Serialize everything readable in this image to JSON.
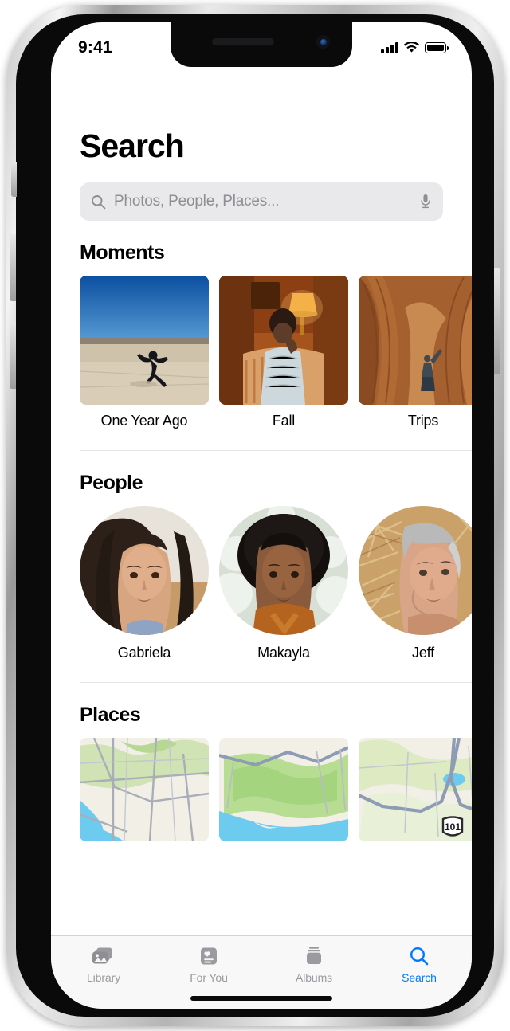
{
  "device": {
    "buttons": [
      "mute-switch",
      "volume-up",
      "volume-down",
      "side-power"
    ]
  },
  "status_bar": {
    "time": "9:41",
    "cellular": "signal-bars-icon",
    "wifi": "wifi-icon",
    "battery": "battery-full-icon"
  },
  "header": {
    "title": "Search"
  },
  "search": {
    "placeholder": "Photos, People, Places...",
    "value": "",
    "leading_icon": "search-icon",
    "trailing_icon": "microphone-icon"
  },
  "sections": {
    "moments": {
      "title": "Moments",
      "items": [
        {
          "label": "One Year Ago",
          "thumb": "desert-jump-photo"
        },
        {
          "label": "Fall",
          "thumb": "person-on-couch-photo"
        },
        {
          "label": "Trips",
          "thumb": "slot-canyon-photo"
        },
        {
          "label": "",
          "thumb": "partial-photo"
        }
      ]
    },
    "people": {
      "title": "People",
      "items": [
        {
          "label": "Gabriela",
          "avatar": "gabriela-portrait"
        },
        {
          "label": "Makayla",
          "avatar": "makayla-portrait"
        },
        {
          "label": "Jeff",
          "avatar": "jeff-portrait"
        },
        {
          "label": "",
          "avatar": "partial-portrait"
        }
      ]
    },
    "places": {
      "title": "Places",
      "items": [
        {
          "thumb": "map-coastal-city",
          "shield": ""
        },
        {
          "thumb": "map-coastline-green",
          "shield": ""
        },
        {
          "thumb": "map-highway",
          "shield": "101"
        },
        {
          "thumb": "map-partial",
          "shield": ""
        }
      ]
    }
  },
  "tab_bar": {
    "active": "Search",
    "accent_color": "#007aff",
    "inactive_color": "#9a9a9f",
    "tabs": [
      {
        "label": "Library",
        "icon": "photo-stack-icon"
      },
      {
        "label": "For You",
        "icon": "heart-card-icon"
      },
      {
        "label": "Albums",
        "icon": "albums-stack-icon"
      },
      {
        "label": "Search",
        "icon": "magnifier-icon"
      }
    ]
  }
}
